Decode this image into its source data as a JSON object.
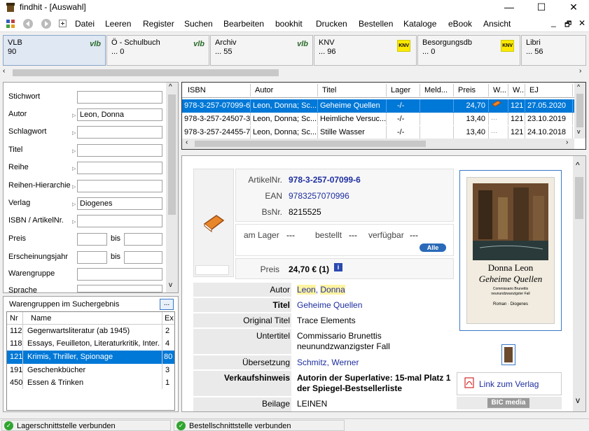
{
  "window": {
    "title": "findhit - [Auswahl]",
    "minimize": "—",
    "maximize": "☐",
    "close": "✕"
  },
  "menu": [
    "Datei",
    "Leeren",
    "Register",
    "Suchen",
    "Bearbeiten",
    "bookhit",
    "Drucken",
    "Bestellen",
    "Kataloge",
    "eBook",
    "Ansicht"
  ],
  "menu_right": {
    "min": "_",
    "restore": "🗗",
    "close": "✕"
  },
  "db_tabs": [
    {
      "name": "VLB",
      "count": "90",
      "badge": "vlb"
    },
    {
      "name": "Ö - Schulbuch",
      "count": "... 0",
      "badge": "vlb"
    },
    {
      "name": "Archiv",
      "count": "... 55",
      "badge": "vlb"
    },
    {
      "name": "KNV",
      "count": "... 96",
      "badge": "KNV"
    },
    {
      "name": "Besorgungsdb",
      "count": "... 0",
      "badge": "KNV"
    },
    {
      "name": "Libri",
      "count": "... 56",
      "badge": ""
    }
  ],
  "search": {
    "fields": [
      {
        "label": "Stichwort",
        "value": ""
      },
      {
        "label": "Autor",
        "value": "Leon, Donna"
      },
      {
        "label": "Schlagwort",
        "value": ""
      },
      {
        "label": "Titel",
        "value": ""
      },
      {
        "label": "Reihe",
        "value": ""
      },
      {
        "label": "Reihen-Hierarchie",
        "value": ""
      },
      {
        "label": "Verlag",
        "value": "Diogenes"
      },
      {
        "label": "ISBN / ArtikelNr.",
        "value": ""
      },
      {
        "label": "Preis",
        "value": ""
      },
      {
        "label": "Erscheinungsjahr",
        "value": ""
      },
      {
        "label": "Warengruppe",
        "value": ""
      },
      {
        "label": "Sprache",
        "value": ""
      }
    ],
    "bis": "bis"
  },
  "warengruppen": {
    "title": "Warengruppen im Suchergebnis",
    "more": "...",
    "headers": [
      "Nr",
      "Name",
      "Ex"
    ],
    "rows": [
      {
        "nr": "112",
        "name": "Gegenwartsliteratur (ab 1945)",
        "ex": "2"
      },
      {
        "nr": "118",
        "name": "Essays, Feuilleton, Literaturkritik, Inter...",
        "ex": "4"
      },
      {
        "nr": "121",
        "name": "Krimis, Thriller, Spionage",
        "ex": "80"
      },
      {
        "nr": "191",
        "name": "Geschenkbücher",
        "ex": "3"
      },
      {
        "nr": "450",
        "name": "Essen & Trinken",
        "ex": "1"
      }
    ]
  },
  "results": {
    "headers": [
      "ISBN",
      "Autor",
      "Titel",
      "Lager",
      "Meld...",
      "Preis",
      "W...",
      "W...",
      "EJ"
    ],
    "rows": [
      {
        "isbn": "978-3-257-07099-6",
        "autor": "Leon, Donna; Sc...",
        "titel": "Geheime Quellen",
        "lager": "-/-",
        "meld": "",
        "preis": "24,70",
        "w2": "121",
        "ej": "27.05.2020"
      },
      {
        "isbn": "978-3-257-24507-3",
        "autor": "Leon, Donna; Sc...",
        "titel": "Heimliche Versuc...",
        "lager": "-/-",
        "meld": "",
        "preis": "13,40",
        "w2": "121",
        "ej": "23.10.2019"
      },
      {
        "isbn": "978-3-257-24455-7",
        "autor": "Leon, Donna; Sc...",
        "titel": "Stille Wasser",
        "lager": "-/-",
        "meld": "",
        "preis": "13,40",
        "w2": "121",
        "ej": "24.10.2018"
      }
    ]
  },
  "detail": {
    "artikelnr_label": "ArtikelNr.",
    "artikelnr": "978-3-257-07099-6",
    "ean_label": "EAN",
    "ean": "9783257070996",
    "bsnr_label": "BsNr.",
    "bsnr": "8215525",
    "lager_label": "am Lager",
    "lager": "---",
    "bestellt_label": "bestellt",
    "bestellt": "---",
    "verfuegbar_label": "verfügbar",
    "verfuegbar": "---",
    "alle": "Alle",
    "preis_label": "Preis",
    "preis": "24,70 € (1)",
    "autor_label": "Autor",
    "autor1": "Leon",
    "autor2": "Donna",
    "titel_label": "Titel",
    "titel": "Geheime Quellen",
    "orig_label": "Original Titel",
    "orig": "Trace Elements",
    "unter_label": "Untertitel",
    "unter1": "Commissario Brunettis",
    "unter2": "neunundzwanzigster Fall",
    "uebers_label": "Übersetzung",
    "uebers": "Schmitz, Werner",
    "vk_label": "Verkaufshinweis",
    "vk1": "Autorin der Superlative: 15-mal Platz 1",
    "vk2": "der Spiegel-Bestsellerliste",
    "beilage_label": "Beilage",
    "beilage": "LEINEN",
    "link": "Link zum Verlag",
    "bic": "BIC media",
    "cover": {
      "author": "Donna Leon",
      "title": "Geheime Quellen",
      "sub1": "Commissario Brunettis",
      "sub2": "neunundzwanzigster Fall",
      "publisher": "Roman · Diogenes"
    }
  },
  "status": [
    "Lagerschnittstelle verbunden",
    "Bestellschnittstelle verbunden"
  ],
  "colors": {
    "selection": "#0078d7",
    "link": "#1e2ea0",
    "highlight": "#fff3a0"
  }
}
